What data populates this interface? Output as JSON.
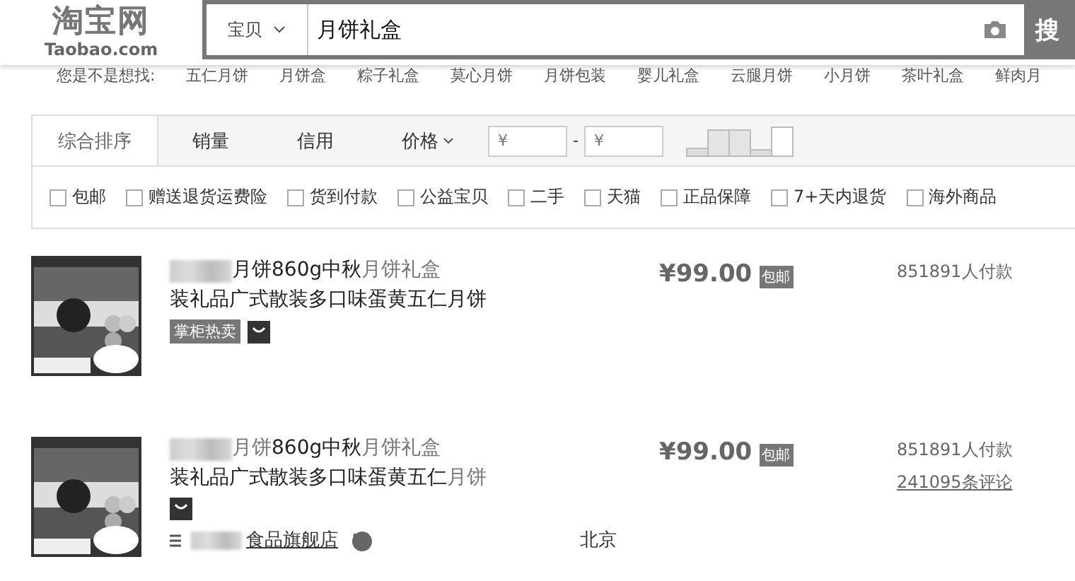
{
  "logo": {
    "name": "淘宝网",
    "domain": "Taobao.com"
  },
  "search": {
    "scope": "宝贝",
    "value": "月饼礼盒",
    "button": "搜"
  },
  "suggestions": {
    "label": "您是不是想找:",
    "items": [
      "五仁月饼",
      "月饼盒",
      "粽子礼盒",
      "莫心月饼",
      "月饼包装",
      "婴儿礼盒",
      "云腿月饼",
      "小月饼",
      "茶叶礼盒",
      "鲜肉月"
    ]
  },
  "sort_tabs": [
    {
      "label": "综合排序",
      "selected": true
    },
    {
      "label": "销量",
      "selected": false
    },
    {
      "label": "信用",
      "selected": false
    },
    {
      "label": "价格",
      "selected": false,
      "kind": "dropdown"
    }
  ],
  "price_range": {
    "min_placeholder": "¥",
    "separator": "-",
    "max_placeholder": "¥"
  },
  "filters": [
    {
      "label": "包邮",
      "checked": false
    },
    {
      "label": "赠送退货运费险",
      "checked": false
    },
    {
      "label": "货到付款",
      "checked": false
    },
    {
      "label": "公益宝贝",
      "checked": false
    },
    {
      "label": "二手",
      "checked": false
    },
    {
      "label": "天猫",
      "checked": false
    },
    {
      "label": "正品保障",
      "checked": false
    },
    {
      "label": "7+天内退货",
      "checked": false
    },
    {
      "label": "海外商品",
      "checked": false
    }
  ],
  "items": [
    {
      "title": [
        {
          "text": "月饼",
          "highlight": false
        },
        {
          "text": "860g中秋",
          "highlight": false
        },
        {
          "text": "月饼礼盒",
          "highlight": true
        },
        {
          "text": "装礼品广式散装多口味蛋黄五仁月饼",
          "highlight": false
        }
      ],
      "price": "¥99.00",
      "shipping_badge": "包邮",
      "sales": "851891人付款",
      "tag": "掌柜热卖"
    },
    {
      "title": [
        {
          "text": "月饼",
          "highlight": true
        },
        {
          "text": "860g中秋",
          "highlight": false
        },
        {
          "text": "月饼礼盒",
          "highlight": true
        },
        {
          "text": "装礼品广式散装多口味蛋黄五仁",
          "highlight": false
        },
        {
          "text": "月饼",
          "highlight": true
        }
      ],
      "price": "¥99.00",
      "shipping_badge": "包邮",
      "sales": "851891人付款",
      "reviews": "241095条评论",
      "shop": "食品旗舰店",
      "location": "北京"
    }
  ]
}
